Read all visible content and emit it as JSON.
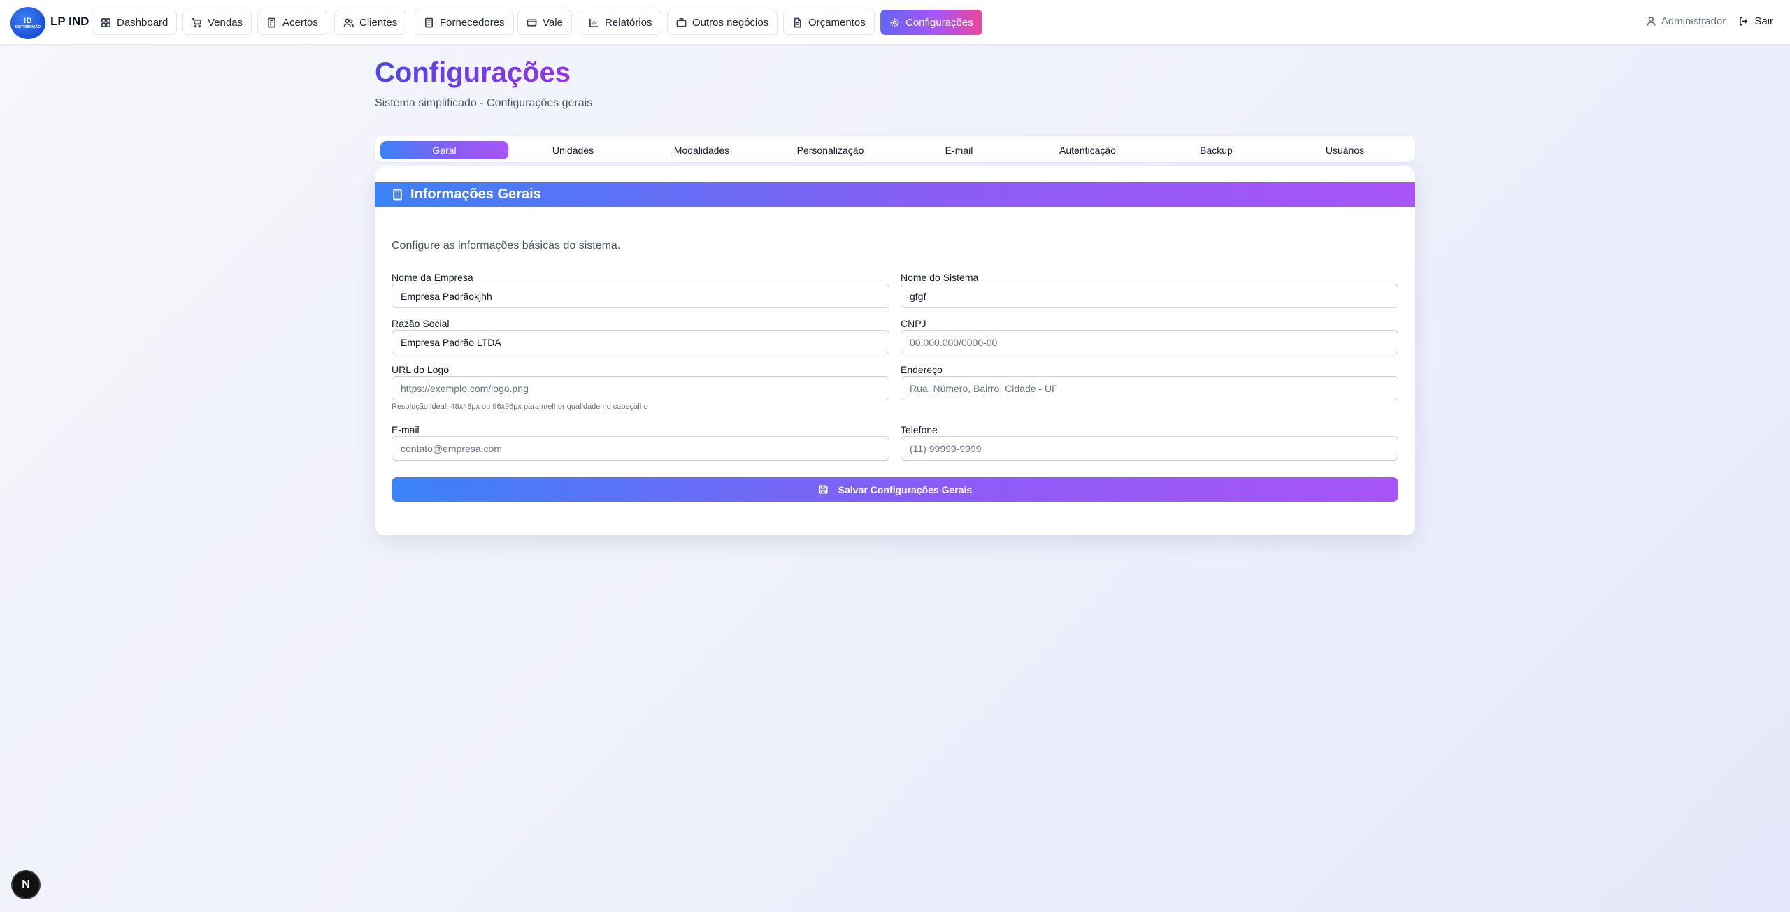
{
  "brand": {
    "logo_text": "ID",
    "logo_subtext": "DISTRIBUIÇÃO",
    "name": "LP IND"
  },
  "nav": {
    "items": [
      {
        "label": "Dashboard",
        "icon": "dashboard-icon"
      },
      {
        "label": "Vendas",
        "icon": "cart-icon"
      },
      {
        "label": "Acertos",
        "icon": "calculator-icon"
      },
      {
        "label": "Clientes",
        "icon": "users-icon"
      },
      {
        "label": "Fornecedores",
        "icon": "building-icon"
      },
      {
        "label": "Vale",
        "icon": "credit-card-icon"
      },
      {
        "label": "Relatórios",
        "icon": "bar-chart-icon"
      },
      {
        "label": "Outros negócios",
        "icon": "briefcase-icon"
      },
      {
        "label": "Orçamentos",
        "icon": "document-icon"
      },
      {
        "label": "Configurações",
        "icon": "gear-icon",
        "active": true
      }
    ]
  },
  "user": {
    "name": "Administrador",
    "logout_label": "Sair"
  },
  "page": {
    "title": "Configurações",
    "subtitle": "Sistema simplificado - Configurações gerais"
  },
  "tabs": [
    {
      "label": "Geral",
      "active": true
    },
    {
      "label": "Unidades"
    },
    {
      "label": "Modalidades"
    },
    {
      "label": "Personalização"
    },
    {
      "label": "E-mail"
    },
    {
      "label": "Autenticação"
    },
    {
      "label": "Backup"
    },
    {
      "label": "Usuários"
    }
  ],
  "card": {
    "title": "Informações Gerais",
    "description": "Configure as informações básicas do sistema.",
    "fields": {
      "company_name": {
        "label": "Nome da Empresa",
        "value": "Empresa Padrãokjhh",
        "placeholder": ""
      },
      "system_name": {
        "label": "Nome do Sistema",
        "value": "gfgf",
        "placeholder": ""
      },
      "legal_name": {
        "label": "Razão Social",
        "value": "Empresa Padrão LTDA",
        "placeholder": ""
      },
      "cnpj": {
        "label": "CNPJ",
        "value": "",
        "placeholder": "00.000.000/0000-00"
      },
      "logo_url": {
        "label": "URL do Logo",
        "value": "",
        "placeholder": "https://exemplo.com/logo.png"
      },
      "address": {
        "label": "Endereço",
        "value": "",
        "placeholder": "Rua, Número, Bairro, Cidade - UF"
      },
      "email": {
        "label": "E-mail",
        "value": "",
        "placeholder": "contato@empresa.com"
      },
      "phone": {
        "label": "Telefone",
        "value": "",
        "placeholder": "(11) 99999-9999"
      }
    },
    "logo_hint": "Resolução ideal: 48x48px ou 96x96px para melhor qualidade no cabeçalho",
    "save_label": "Salvar Configurações Gerais"
  },
  "badge": {
    "label": "N"
  },
  "colors": {
    "accent_start": "#3b82f6",
    "accent_mid": "#8b5cf6",
    "accent_end": "#a855f7",
    "nav_active_end": "#ec4899"
  }
}
